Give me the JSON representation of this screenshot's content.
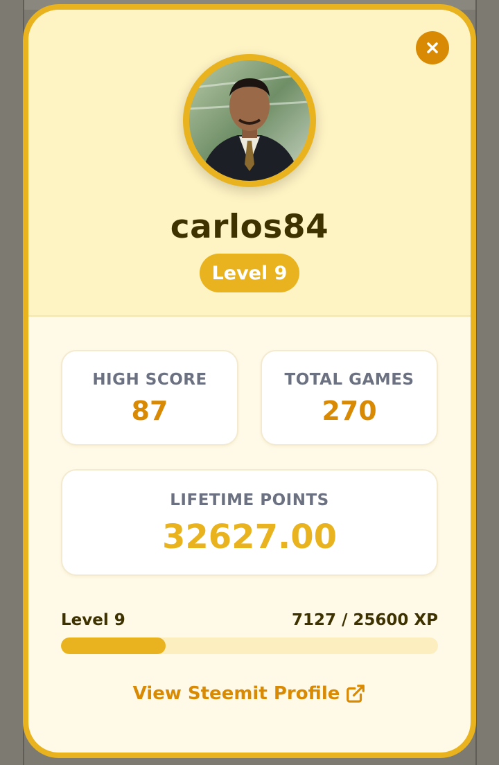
{
  "profile": {
    "username": "carlos84",
    "level_badge": "Level 9",
    "avatar_alt": "carlos84 avatar"
  },
  "stats": {
    "high_score": {
      "label": "HIGH SCORE",
      "value": "87"
    },
    "total_games": {
      "label": "TOTAL GAMES",
      "value": "270"
    },
    "lifetime_points": {
      "label": "LIFETIME POINTS",
      "value": "32627.00"
    }
  },
  "progress": {
    "level_label": "Level 9",
    "xp_text": "7127 / 25600 XP",
    "xp_current": 7127,
    "xp_max": 25600
  },
  "link": {
    "label": "View Steemit Profile"
  },
  "icons": {
    "close": "close-icon",
    "external": "external-link-icon"
  },
  "colors": {
    "accent": "#e8b31e",
    "accent_dark": "#d98a05",
    "header_bg": "#fef3c3",
    "body_bg": "#fffae8",
    "text_dark": "#3d3200",
    "label_gray": "#6b7180"
  }
}
